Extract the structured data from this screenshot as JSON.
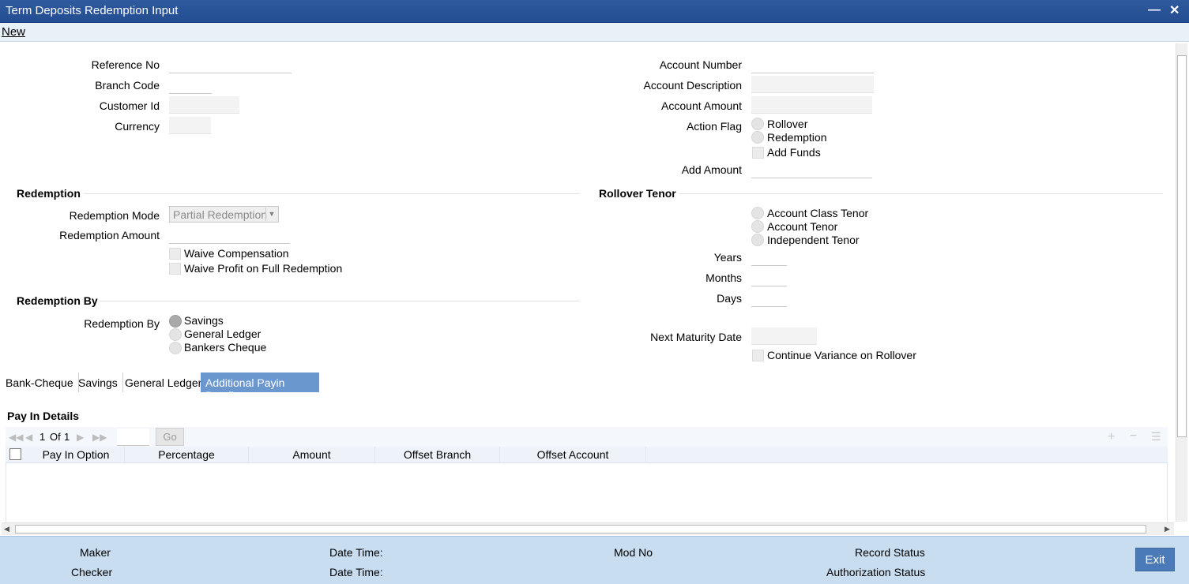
{
  "window": {
    "title": "Term Deposits Redemption Input",
    "minimize_icon": "minimize-icon",
    "close_icon": "close-icon"
  },
  "menu": {
    "new_label": "New"
  },
  "header": {
    "reference_no": "Reference No",
    "branch_code": "Branch Code",
    "customer_id": "Customer Id",
    "currency": "Currency",
    "account_number": "Account Number",
    "account_description": "Account Description",
    "account_amount": "Account Amount",
    "action_flag": "Action Flag",
    "action_flag_options": [
      "Rollover",
      "Redemption"
    ],
    "add_funds": "Add Funds",
    "add_amount": "Add Amount"
  },
  "redemption": {
    "section": "Redemption",
    "mode_label": "Redemption Mode",
    "mode_value": "Partial Redemption",
    "amount_label": "Redemption Amount",
    "waive_comp": "Waive Compensation",
    "waive_profit": "Waive Profit on Full Redemption"
  },
  "redemption_by": {
    "section": "Redemption By",
    "label": "Redemption By",
    "options": [
      "Savings",
      "General Ledger",
      "Bankers Cheque"
    ],
    "selected": "Savings"
  },
  "rollover": {
    "section": "Rollover Tenor",
    "options": [
      "Account Class Tenor",
      "Account Tenor",
      "Independent Tenor"
    ],
    "years": "Years",
    "months": "Months",
    "days": "Days",
    "next_maturity": "Next Maturity Date",
    "continue_variance": "Continue Variance on Rollover"
  },
  "tabs": [
    "Bank-Cheque",
    "Savings",
    "General Ledger",
    "Additional Payin Details"
  ],
  "active_tab": "Additional Payin Details",
  "payin": {
    "title": "Pay In Details",
    "page_current": "1",
    "page_of": "Of",
    "page_total": "1",
    "go_label": "Go",
    "columns": [
      "Pay In Option",
      "Percentage",
      "Amount",
      "Offset Branch",
      "Offset Account"
    ]
  },
  "footer": {
    "maker": "Maker",
    "checker": "Checker",
    "date_time_1": "Date Time:",
    "date_time_2": "Date Time:",
    "mod_no": "Mod No",
    "record_status": "Record Status",
    "authorization_status": "Authorization Status",
    "exit_label": "Exit"
  }
}
